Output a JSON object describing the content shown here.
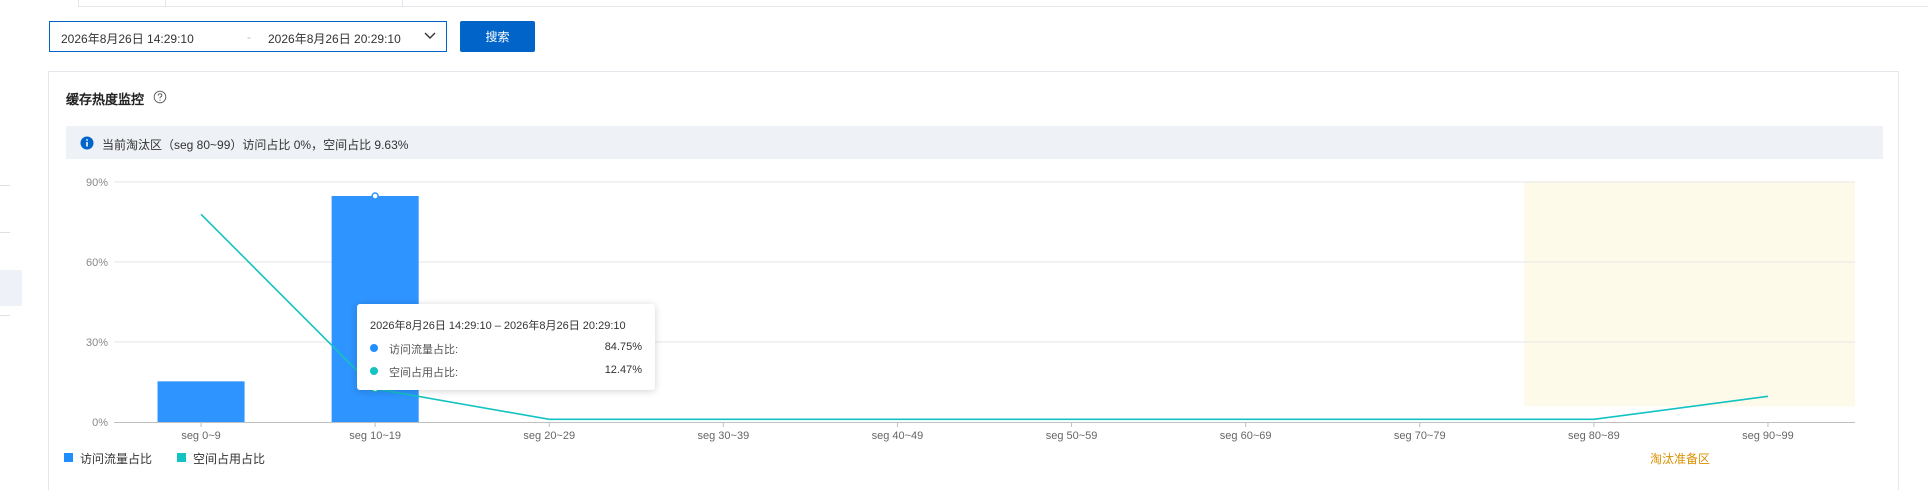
{
  "filters": {
    "start_time": "2026年8月26日 14:29:10",
    "separator": "-",
    "end_time": "2026年8月26日 20:29:10",
    "search_label": "搜索"
  },
  "card": {
    "title": "缓存热度监控",
    "info_text": "当前淘汰区（seg 80~99）访问占比 0%，空间占比 9.63%"
  },
  "tooltip": {
    "title": "2026年8月26日 14:29:10 – 2026年8月26日 20:29:10",
    "rows": [
      {
        "label": "访问流量占比:",
        "value": "84.75%",
        "color": "#1f8fff"
      },
      {
        "label": "空间占用占比:",
        "value": "12.47%",
        "color": "#13c2c2"
      }
    ]
  },
  "zone_label": "淘汰准备区",
  "chart_data": {
    "type": "bar",
    "categories": [
      "seg 0~9",
      "seg 10~19",
      "seg 20~29",
      "seg 30~39",
      "seg 40~49",
      "seg 50~59",
      "seg 60~69",
      "seg 70~79",
      "seg 80~89",
      "seg 90~99"
    ],
    "y_ticks": [
      "0%",
      "30%",
      "60%",
      "90%"
    ],
    "ylim": [
      0,
      90
    ],
    "grid": true,
    "legend_position": "bottom-left",
    "series": [
      {
        "name": "访问流量占比",
        "kind": "bar",
        "color": "#2e94ff",
        "values": [
          15.25,
          84.75,
          0,
          0,
          0,
          0,
          0,
          0,
          0,
          0
        ]
      },
      {
        "name": "空间占用占比",
        "kind": "line",
        "color": "#13c2c2",
        "values": [
          77.9,
          12.47,
          1.0,
          1.0,
          1.0,
          1.0,
          1.0,
          1.0,
          1.0,
          9.63
        ]
      }
    ],
    "highlight_zone": {
      "categories": [
        "seg 80~89",
        "seg 90~99"
      ],
      "color": "#fdfaea"
    }
  }
}
